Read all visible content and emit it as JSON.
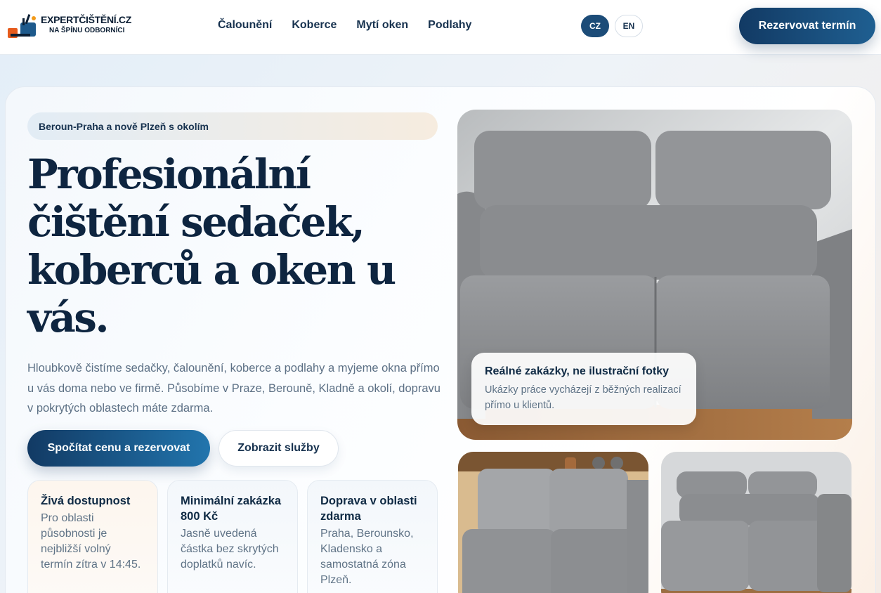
{
  "header": {
    "logo_line1": "EXPERTČIŠTĚNÍ.CZ",
    "logo_line2": "NA ŠPÍNU ODBORNÍCI",
    "nav": [
      "Čalounění",
      "Koberce",
      "Mytí oken",
      "Podlahy"
    ],
    "lang_cz": "CZ",
    "lang_en": "EN",
    "cta": "Rezervovat termín"
  },
  "hero": {
    "badge": "Beroun-Praha a nově Plzeň s okolím",
    "headline": "Profesionální čištění sedaček, koberců a oken u vás.",
    "lead": "Hloubkově čistíme sedačky, čalounění, koberce a podlahy a myjeme okna přímo u vás doma nebo ve firmě. Působíme v Praze, Berouně, Kladně a okolí, dopravu v pokrytých oblastech máte zdarma.",
    "primary_button": "Spočítat cenu a rezervovat",
    "secondary_button": "Zobrazit služby",
    "features": [
      {
        "title": "Živá dostupnost",
        "text": "Pro oblasti působnosti je nejbližší volný termín zítra v 14:45."
      },
      {
        "title": "Minimální zakázka 800 Kč",
        "text": "Jasně uvedená částka bez skrytých doplatků navíc."
      },
      {
        "title": "Doprava v oblasti zdarma",
        "text": "Praha, Berounsko, Kladensko a samostatná zóna Plzeň."
      }
    ]
  },
  "gallery": {
    "caption_title": "Reálné zakázky, ne ilustrační fotky",
    "caption_text": "Ukázky práce vycházejí z běžných realizací přímo u klientů."
  },
  "colors": {
    "navy": "#0e2540",
    "accent": "#1f5f91",
    "sofa": "#8d8f92"
  }
}
